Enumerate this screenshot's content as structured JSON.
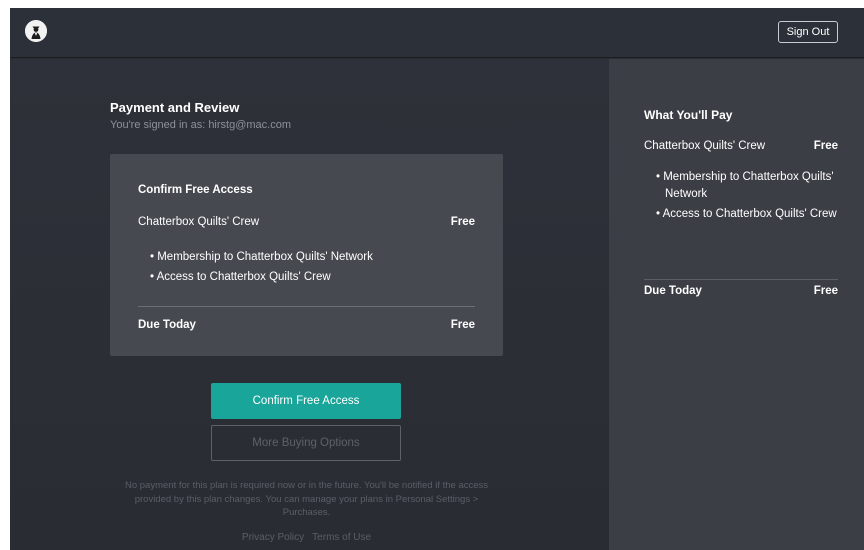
{
  "header": {
    "sign_out_label": "Sign Out"
  },
  "main": {
    "title": "Payment and Review",
    "signed_in_text": "You're signed in as: hirstg@mac.com",
    "card": {
      "title": "Confirm Free Access",
      "plan_name": "Chatterbox Quilts' Crew",
      "plan_price": "Free",
      "benefits": [
        "• Membership to Chatterbox Quilts' Network",
        "• Access to Chatterbox Quilts' Crew"
      ],
      "due_label": "Due Today",
      "due_price": "Free"
    },
    "confirm_button_label": "Confirm Free Access",
    "more_button_label": "More Buying Options",
    "note": "No payment for this plan is required now or in the future. You'll be notified if the access provided by this plan changes. You can manage your plans in Personal Settings > Purchases.",
    "footer_links": [
      "Privacy Policy",
      "Terms of Use"
    ]
  },
  "sidebar": {
    "title": "What You'll Pay",
    "plan_name": "Chatterbox Quilts' Crew",
    "plan_price": "Free",
    "benefits": [
      "• Membership to Chatterbox Quilts' Network",
      "• Access to Chatterbox Quilts' Crew"
    ],
    "due_label": "Due Today",
    "due_price": "Free"
  },
  "colors": {
    "accent": "#1aa59a",
    "background": "#2a2c32",
    "card": "#474950",
    "sidebar": "#3c3e45"
  },
  "icons": {
    "avatar": "user-avatar-icon"
  }
}
